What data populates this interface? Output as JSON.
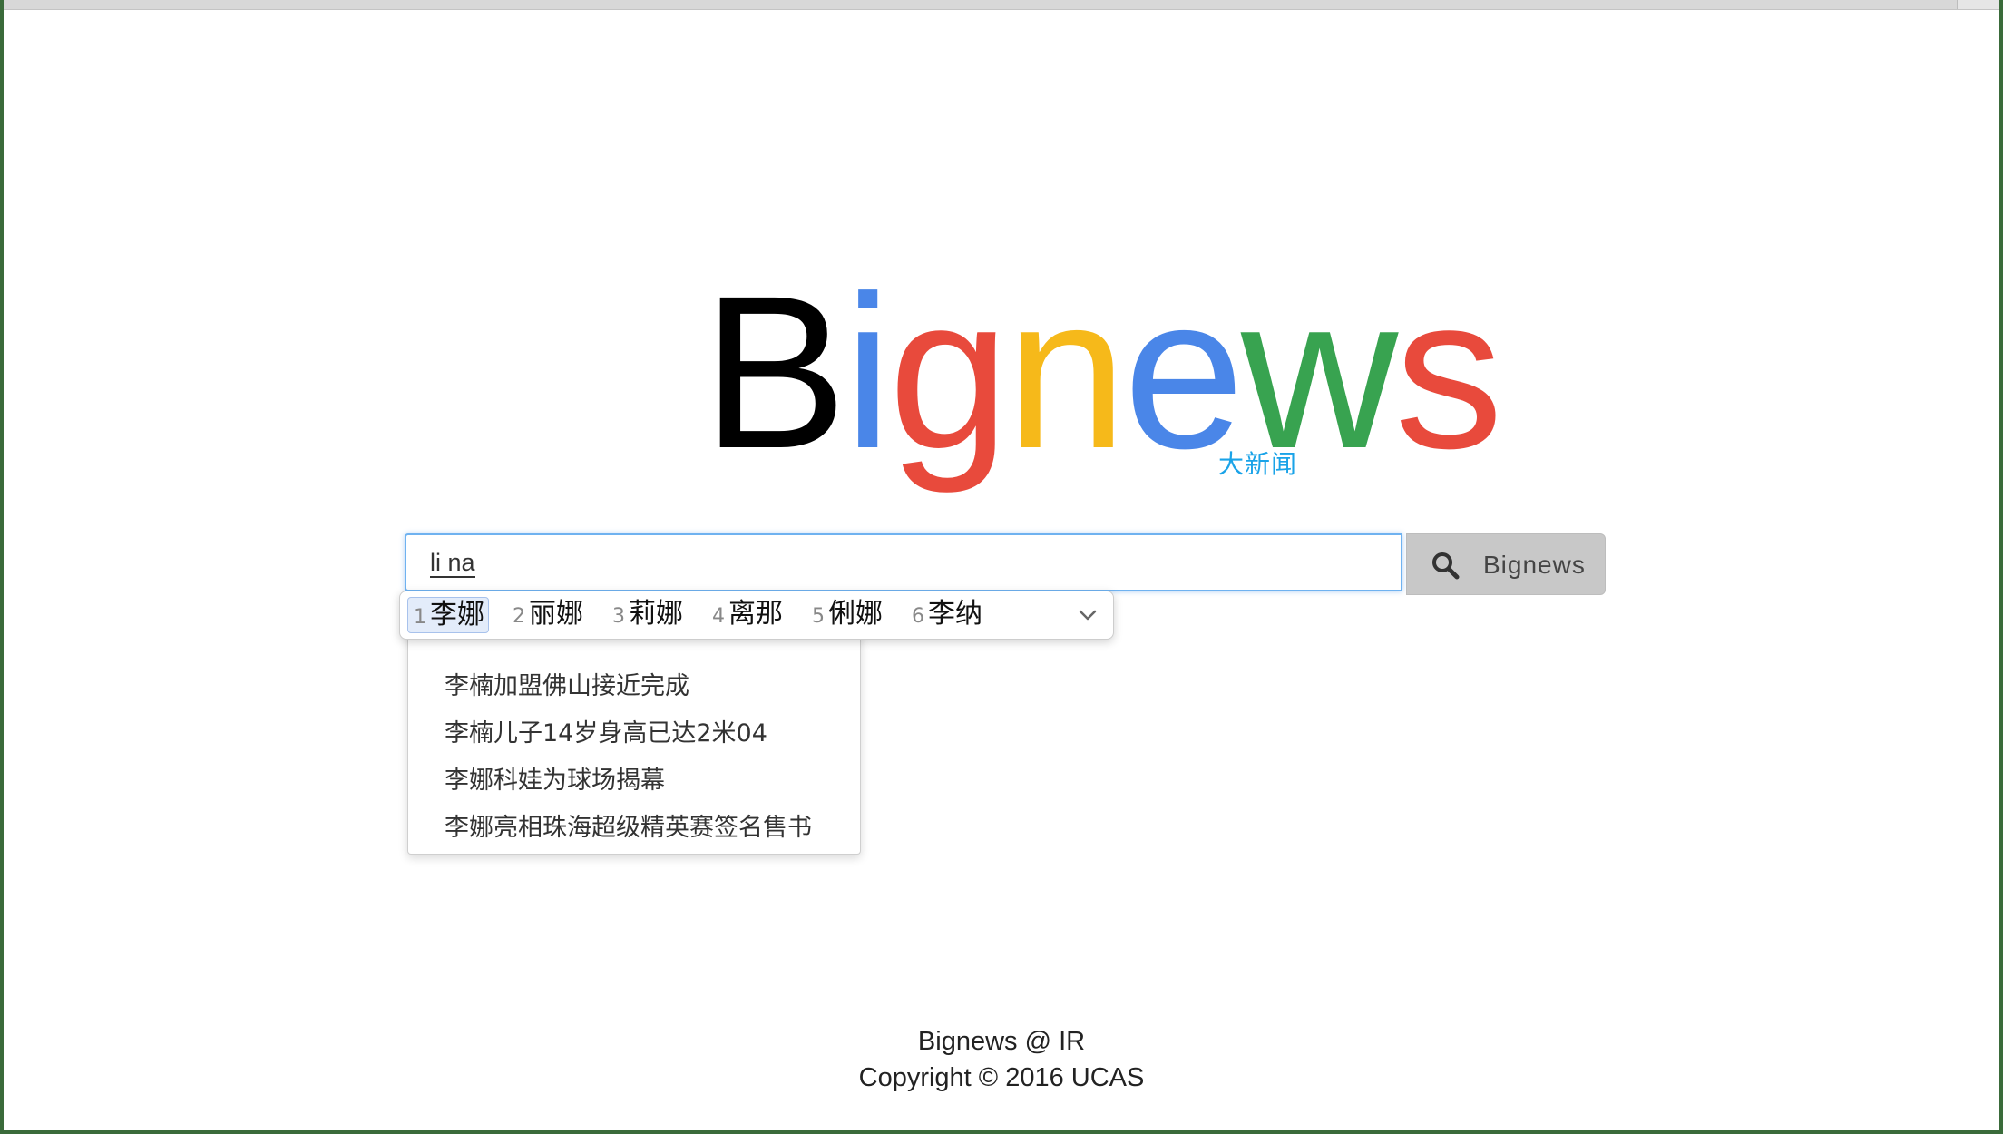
{
  "logo": {
    "letters": [
      {
        "char": "B",
        "color": "#000000"
      },
      {
        "char": "i",
        "color": "#4a86e8"
      },
      {
        "char": "g",
        "color": "#e84a3c"
      },
      {
        "char": "n",
        "color": "#f6b91a"
      },
      {
        "char": "e",
        "color": "#4a86e8"
      },
      {
        "char": "w",
        "color": "#38a350"
      },
      {
        "char": "s",
        "color": "#e84a3c"
      }
    ],
    "subtitle": "大新闻",
    "subtitle_color": "#1aa3e8"
  },
  "search": {
    "value": "li na",
    "button_label": "Bignews",
    "button_icon": "search-icon"
  },
  "ime": {
    "candidates": [
      {
        "num": "1",
        "word": "李娜",
        "selected": true
      },
      {
        "num": "2",
        "word": "丽娜"
      },
      {
        "num": "3",
        "word": "莉娜"
      },
      {
        "num": "4",
        "word": "离那"
      },
      {
        "num": "5",
        "word": "俐娜"
      },
      {
        "num": "6",
        "word": "李纳"
      }
    ],
    "expand_icon": "chevron-down-icon"
  },
  "suggestions": [
    "李楠加盟佛山接近完成",
    "李楠儿子14岁身高已达2米04",
    "李娜科娃为球场揭幕",
    "李娜亮相珠海超级精英赛签名售书"
  ],
  "footer": {
    "line1": "Bignews @ IR",
    "line2": "Copyright © 2016 UCAS"
  }
}
